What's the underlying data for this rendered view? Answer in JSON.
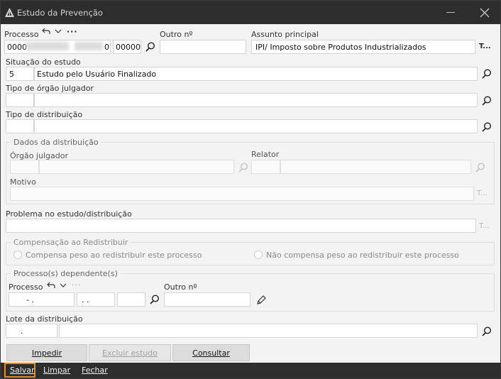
{
  "window": {
    "title": "Estudo da Prevenção",
    "icon": "app-logo-icon"
  },
  "processo": {
    "label": "Processo",
    "part1": "0000",
    "part2": "0",
    "part3": "00000",
    "more": "···"
  },
  "outro_numero": {
    "label": "Outro nº",
    "value": ""
  },
  "assunto": {
    "label": "Assunto principal",
    "value": "IPI/ Imposto sobre Produtos Industrializados",
    "more": "T..."
  },
  "situacao": {
    "label": "Situação do estudo",
    "code": "5",
    "value": "Estudo pelo Usuário Finalizado"
  },
  "tipo_orgao": {
    "label": "Tipo de órgão julgador",
    "code": "",
    "value": ""
  },
  "tipo_distribuicao": {
    "label": "Tipo de distribuição",
    "code": "",
    "value": ""
  },
  "dados_distribuicao": {
    "title": "Dados da distribuição",
    "orgao_label": "Órgão julgador",
    "relator_label": "Relator",
    "motivo_label": "Motivo",
    "more": "T..."
  },
  "problema": {
    "label": "Problema no estudo/distribuição",
    "value": "",
    "more": "T..."
  },
  "compensacao": {
    "title": "Compensação ao Redistribuir",
    "opt1": "Compensa peso ao redistribuir este processo",
    "opt2": "Não compensa peso ao redistribuir este processo"
  },
  "dependentes": {
    "title": "Processo(s) dependente(s)",
    "processo_label": "Processo",
    "outro_label": "Outro nº",
    "p1": "- .",
    "p2": ". .",
    "more": "···"
  },
  "lote": {
    "label": "Lote da distribuição",
    "code": ".",
    "value": ""
  },
  "buttons": {
    "impedir": "Impedir",
    "excluir": "Excluir estudo",
    "consultar": "Consultar"
  },
  "footer": {
    "salvar": "Salvar",
    "limpar": "Limpar",
    "fechar": "Fechar"
  }
}
